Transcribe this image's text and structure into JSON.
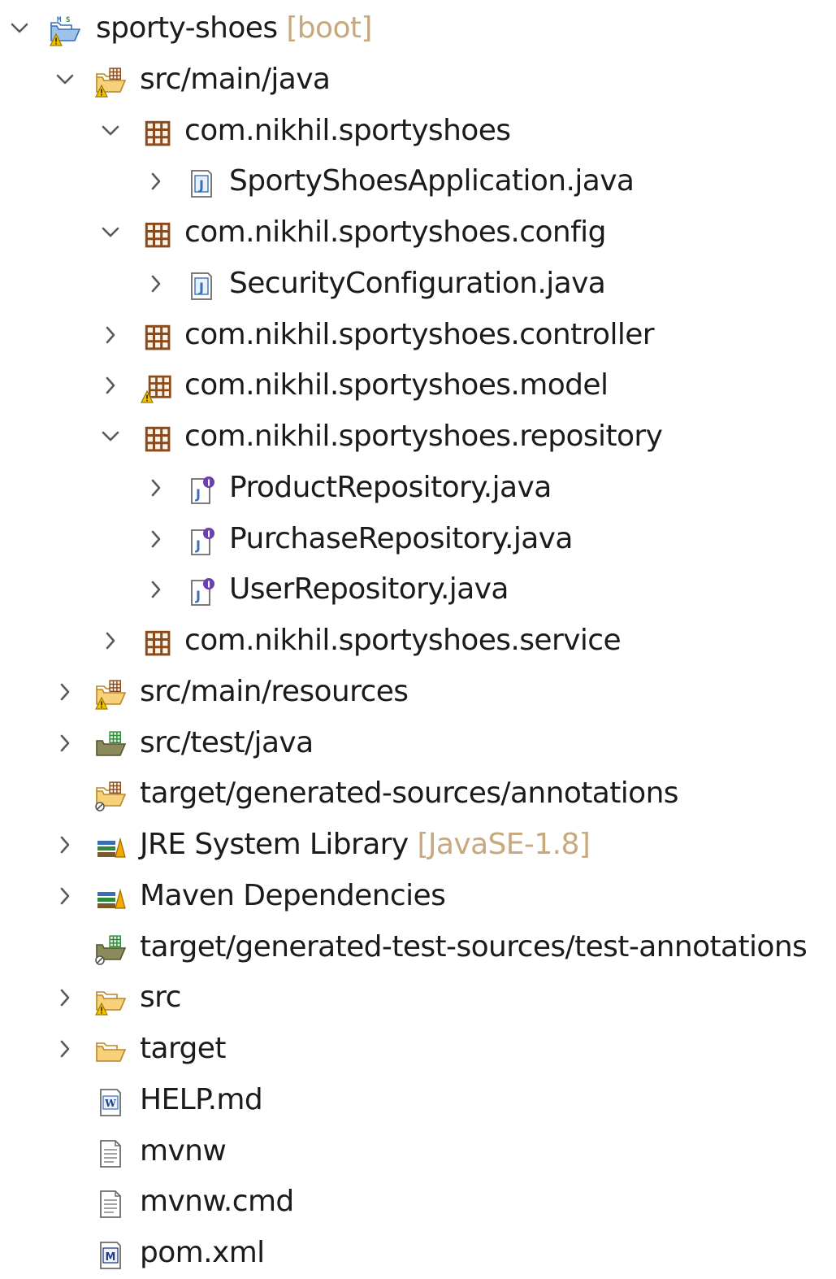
{
  "tree": [
    {
      "label": "sporty-shoes",
      "decoration": "[boot]",
      "depth": 0,
      "chevron": "expanded",
      "icon": "boot-project-icon"
    },
    {
      "label": "src/main/java",
      "depth": 1,
      "chevron": "expanded",
      "icon": "source-folder-warning-icon"
    },
    {
      "label": "com.nikhil.sportyshoes",
      "depth": 2,
      "chevron": "expanded",
      "icon": "package-icon"
    },
    {
      "label": "SportyShoesApplication.java",
      "depth": 3,
      "chevron": "collapsed",
      "icon": "java-file-icon"
    },
    {
      "label": "com.nikhil.sportyshoes.config",
      "depth": 2,
      "chevron": "expanded",
      "icon": "package-icon"
    },
    {
      "label": "SecurityConfiguration.java",
      "depth": 3,
      "chevron": "collapsed",
      "icon": "java-file-icon"
    },
    {
      "label": "com.nikhil.sportyshoes.controller",
      "depth": 2,
      "chevron": "collapsed",
      "icon": "package-icon"
    },
    {
      "label": "com.nikhil.sportyshoes.model",
      "depth": 2,
      "chevron": "collapsed",
      "icon": "package-warning-icon"
    },
    {
      "label": "com.nikhil.sportyshoes.repository",
      "depth": 2,
      "chevron": "expanded",
      "icon": "package-icon"
    },
    {
      "label": "ProductRepository.java",
      "depth": 3,
      "chevron": "collapsed",
      "icon": "java-interface-file-icon"
    },
    {
      "label": "PurchaseRepository.java",
      "depth": 3,
      "chevron": "collapsed",
      "icon": "java-interface-file-icon"
    },
    {
      "label": "UserRepository.java",
      "depth": 3,
      "chevron": "collapsed",
      "icon": "java-interface-file-icon"
    },
    {
      "label": "com.nikhil.sportyshoes.service",
      "depth": 2,
      "chevron": "collapsed",
      "icon": "package-icon"
    },
    {
      "label": "src/main/resources",
      "depth": 1,
      "chevron": "collapsed",
      "icon": "source-folder-warning-icon"
    },
    {
      "label": "src/test/java",
      "depth": 1,
      "chevron": "collapsed",
      "icon": "test-source-folder-icon"
    },
    {
      "label": "target/generated-sources/annotations",
      "depth": 1,
      "chevron": "none",
      "icon": "generated-source-folder-icon"
    },
    {
      "label": "JRE System Library",
      "decoration": "[JavaSE-1.8]",
      "depth": 1,
      "chevron": "collapsed",
      "icon": "library-icon"
    },
    {
      "label": "Maven Dependencies",
      "depth": 1,
      "chevron": "collapsed",
      "icon": "library-icon"
    },
    {
      "label": "target/generated-test-sources/test-annotations",
      "depth": 1,
      "chevron": "none",
      "icon": "generated-test-source-folder-icon"
    },
    {
      "label": "src",
      "depth": 1,
      "chevron": "collapsed",
      "icon": "folder-warning-icon"
    },
    {
      "label": "target",
      "depth": 1,
      "chevron": "collapsed",
      "icon": "folder-icon"
    },
    {
      "label": "HELP.md",
      "depth": 1,
      "chevron": "none",
      "icon": "markdown-file-icon"
    },
    {
      "label": "mvnw",
      "depth": 1,
      "chevron": "none",
      "icon": "text-file-icon"
    },
    {
      "label": "mvnw.cmd",
      "depth": 1,
      "chevron": "none",
      "icon": "text-file-icon"
    },
    {
      "label": "pom.xml",
      "depth": 1,
      "chevron": "none",
      "icon": "maven-pom-file-icon"
    }
  ],
  "colors": {
    "text": "#1b1b1b",
    "decoration": "#c8a97e",
    "chevron": "#5a5a5a",
    "package_brown": "#8a4a1c",
    "folder_yellow": "#e8b54a",
    "warning_yellow": "#f2c200",
    "java_blue": "#3b6fb6",
    "interface_purple": "#6a3fb0",
    "test_green": "#2f8a3a"
  }
}
